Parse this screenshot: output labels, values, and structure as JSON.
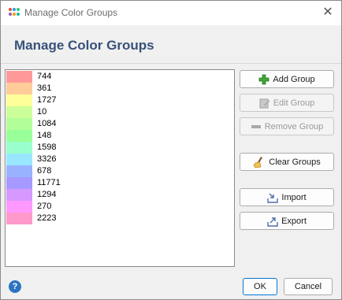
{
  "window": {
    "title": "Manage Color Groups",
    "close_glyph": "✕"
  },
  "header": {
    "title": "Manage Color Groups"
  },
  "groups": [
    {
      "label": "744",
      "color": "#ff9999"
    },
    {
      "label": "361",
      "color": "#ffcc99"
    },
    {
      "label": "1727",
      "color": "#ffff99"
    },
    {
      "label": "10",
      "color": "#ccff99"
    },
    {
      "label": "1084",
      "color": "#b2ff99"
    },
    {
      "label": "148",
      "color": "#99ff99"
    },
    {
      "label": "1598",
      "color": "#99ffcc"
    },
    {
      "label": "3326",
      "color": "#99e6ff"
    },
    {
      "label": "678",
      "color": "#99b2ff"
    },
    {
      "label": "11771",
      "color": "#a699ff"
    },
    {
      "label": "1294",
      "color": "#d699ff"
    },
    {
      "label": "270",
      "color": "#ff99ff"
    },
    {
      "label": "2223",
      "color": "#ff99cc"
    }
  ],
  "buttons": {
    "add": "Add Group",
    "edit": "Edit Group",
    "remove": "Remove Group",
    "clear": "Clear Groups",
    "import": "Import",
    "export": "Export",
    "ok": "OK",
    "cancel": "Cancel"
  },
  "help_glyph": "?"
}
